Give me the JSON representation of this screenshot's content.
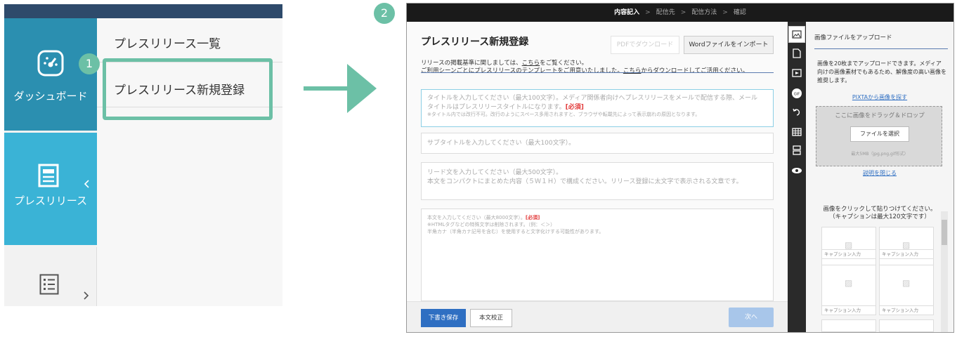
{
  "left_panel": {
    "nav": {
      "dashboard_label": "ダッシュボード",
      "press_release_label": "プレスリリース"
    },
    "submenu": {
      "list_label": "プレスリリース一覧",
      "new_label": "プレスリリース新規登録"
    },
    "badge_1": "1"
  },
  "badge_2": "2",
  "editor": {
    "steps": [
      "内容記入",
      "配信先",
      "配信方法",
      "確認"
    ],
    "current_step": "内容記入",
    "step_sep": ">",
    "title": "プレスリリース新規登録",
    "pdf_button": "PDFでダウンロード",
    "word_button": "Wordファイルをインポート",
    "note1_pre": "リリースの掲載基準に関しましては、",
    "note1_link": "こちら",
    "note1_post": "をご覧ください。",
    "note2_pre": "ご利用シーンごとにプレスリリースのテンプレートをご用意いたしました。",
    "note2_link": "こちら",
    "note2_post": "からダウンロードしてご活用ください。",
    "title_field": {
      "line1": "タイトルを入力してください（最大100文字）。メディア関係者向けへプレスリリースをメールで配信する際、メール",
      "line2": "タイトルはプレスリリースタイトルになります。",
      "required": "[必須]",
      "note": "※タイトル内では改行不可。改行のようにスペース多用されますと、ブラウザや転載先によって表示崩れの原因となります。"
    },
    "subtitle_placeholder": "サブタイトルを入力してください（最大100文字）。",
    "lead_field": {
      "line1": "リード文を入力してください（最大500文字）。",
      "line2": "本文をコンパクトにまとめた内容（５Ｗ１Ｈ）で構成ください。リリース登録に太文字で表示される文章です。"
    },
    "body_field": {
      "line1": "本文を入力してください（最大8000文字）。",
      "required": "[必須]",
      "line2": "※HTMLタグなどの特殊文字は削除されます。（例：＜＞）",
      "line3": "半角カナ（半角カナ記号を含む）を使用すると文字化けする可能性があります。"
    },
    "draft_button": "下書き保存",
    "proofread_button": "本文校正",
    "next_button": "次へ"
  },
  "tools": {
    "icons": [
      "image-icon",
      "document-icon",
      "video-icon",
      "gif-icon",
      "embed-icon",
      "table-icon",
      "quote-icon",
      "preview-icon"
    ]
  },
  "image_panel": {
    "title": "画像ファイルをアップロード",
    "description": "画像を20枚までアップロードできます。メディア向けの画像素材でもあるため、解像度の高い画像を推奨します。",
    "pixta_link": "PIXTAから画像を探す",
    "dropzone_text": "ここに画像をドラッグ＆ドロップ",
    "choose_file": "ファイルを選択",
    "size_note": "最大5MB（jpg,png,gif形式）",
    "close_link": "説明を閉じる",
    "instruction_line1": "画像をクリックして貼りつけてください。",
    "instruction_line2": "（キャプションは最大120文字です）",
    "caption_placeholder": "キャプション入力"
  },
  "colors": {
    "accent_green": "#6cc0a6",
    "dashboard_blue": "#2b8fb0",
    "press_blue": "#3ab3d6",
    "topbar_navy": "#2e4a6b",
    "primary_button": "#2f6fc2"
  }
}
